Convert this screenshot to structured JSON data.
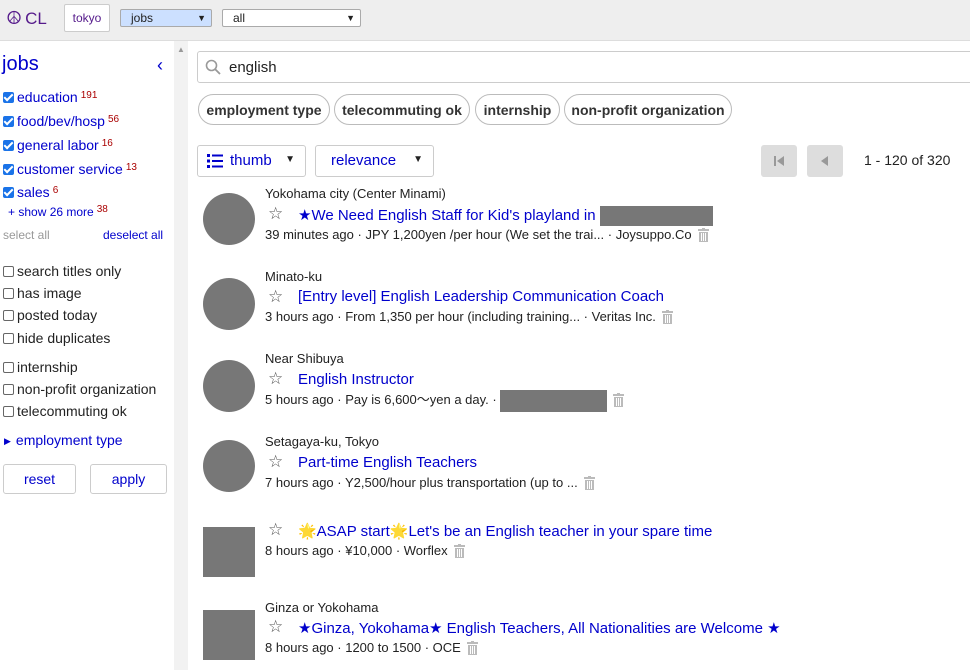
{
  "topbar": {
    "logo_symbol": "☮",
    "logo_text": "CL",
    "city": "tokyo",
    "category_select": "jobs",
    "subcategory_select": "all"
  },
  "sidebar": {
    "title": "jobs",
    "categories": [
      {
        "label": "education",
        "count": "191",
        "checked": true
      },
      {
        "label": "food/bev/hosp",
        "count": "56",
        "checked": true
      },
      {
        "label": "general labor",
        "count": "16",
        "checked": true
      },
      {
        "label": "customer service",
        "count": "13",
        "checked": true
      },
      {
        "label": "sales",
        "count": "6",
        "checked": true
      }
    ],
    "show_more": "+ show 26 more",
    "show_more_count": "38",
    "select_all": "select all",
    "deselect_all": "deselect all",
    "options_a": [
      {
        "label": "search titles only",
        "checked": false
      },
      {
        "label": "has image",
        "checked": false
      },
      {
        "label": "posted today",
        "checked": false
      },
      {
        "label": "hide duplicates",
        "checked": false
      }
    ],
    "options_b": [
      {
        "label": "internship",
        "checked": false
      },
      {
        "label": "non-profit organization",
        "checked": false
      },
      {
        "label": "telecommuting ok",
        "checked": false
      }
    ],
    "employment_type": "employment type",
    "reset": "reset",
    "apply": "apply"
  },
  "search": {
    "value": "english"
  },
  "chips": [
    "employment type",
    "telecommuting ok",
    "internship",
    "non-profit organization"
  ],
  "toolbar": {
    "view": "thumb",
    "sort": "relevance",
    "range": "1 - 120 of 320"
  },
  "results": [
    {
      "location": "Yokohama city (Center Minami)",
      "title": "★We Need English Staff for Kid's playland in",
      "meta": "39 minutes ago  · JPY 1,200yen /per hour (We set the trai... · Joysuppo.Co"
    },
    {
      "location": "Minato-ku",
      "title": "[Entry level] English Leadership Communication Coach",
      "meta": "3 hours ago  · From 1,350 per hour (including training... · Veritas Inc."
    },
    {
      "location": "Near Shibuya",
      "title": "English Instructor",
      "meta": "5 hours ago  · Pay is 6,600～yen a day. ·"
    },
    {
      "location": "Setagaya-ku, Tokyo",
      "title": "Part-time English Teachers",
      "meta": "7 hours ago  · Y2,500/hour plus transportation (up to ..."
    },
    {
      "location": "",
      "title": "🌟ASAP start🌟Let's be an English teacher in your spare time",
      "meta": "8 hours ago  · ¥10,000 · Worflex"
    },
    {
      "location": "Ginza or Yokohama",
      "title": "★Ginza, Yokohama★ English Teachers, All Nationalities are Welcome ★",
      "meta": "8 hours ago  · 1200 to 1500 · OCE"
    }
  ]
}
